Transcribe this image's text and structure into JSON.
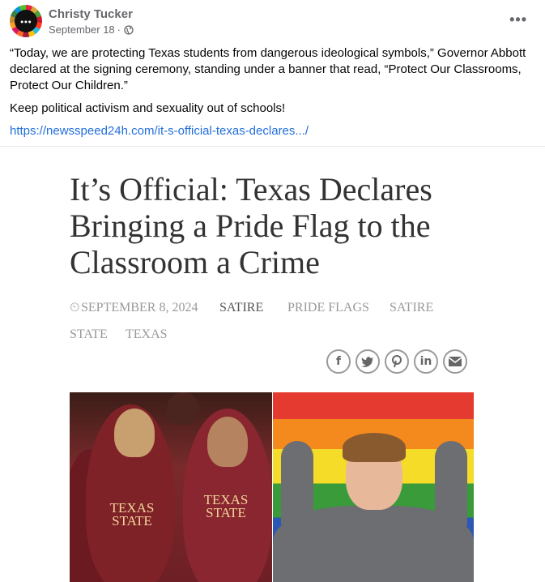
{
  "post": {
    "author": "Christy Tucker",
    "date": "September 18",
    "separator": "·",
    "more_label": "•••",
    "body_1": "“Today, we are protecting Texas students from dangerous ideological symbols,” Governor Abbott declared at the signing ceremony, standing under a banner that read, “Protect Our Classrooms, Protect Our Children.”",
    "body_2": "Keep political activism and sexuality out of schools!",
    "link": "https://newsspeed24h.com/it-s-official-texas-declares.../"
  },
  "article": {
    "headline": "It’s Official: Texas Declares Bringing a Pride Flag to the Classroom a Crime",
    "date": "SEPTEMBER 8, 2024",
    "tags": [
      "SATIRE",
      "PRIDE FLAGS",
      "SATIRE",
      "STATE",
      "TEXAS"
    ],
    "share_icons": [
      "facebook-icon",
      "twitter-icon",
      "pinterest-icon",
      "linkedin-icon",
      "email-icon"
    ],
    "shirt_text_1": "TEXAS STATE",
    "shirt_text_2": "TEXAS STATE"
  },
  "colors": {
    "link": "#216fdb",
    "meta_gray": "#65676b",
    "headline": "#333333"
  }
}
